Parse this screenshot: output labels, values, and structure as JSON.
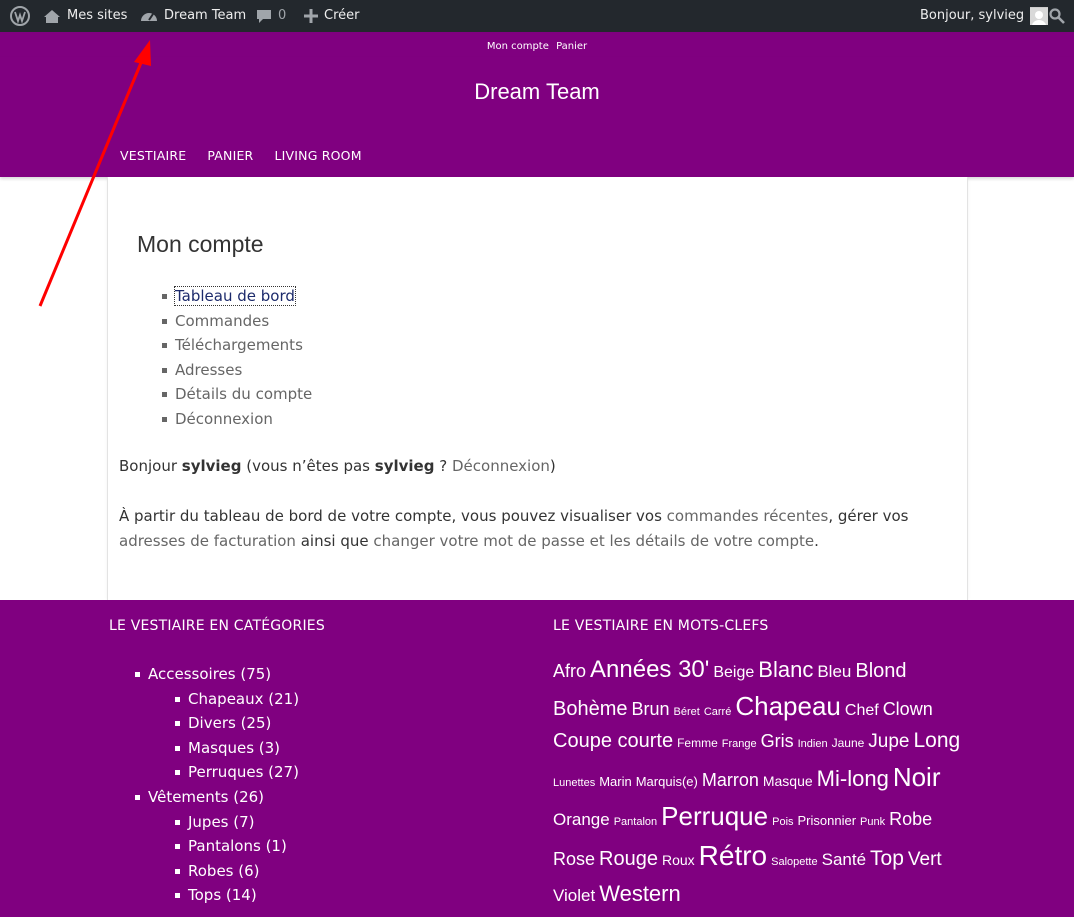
{
  "adminbar": {
    "items": [
      {
        "label": "Mes sites"
      },
      {
        "label": "Dream Team"
      },
      {
        "label": "0"
      },
      {
        "label": "Créer"
      }
    ],
    "greeting": "Bonjour, sylvieg"
  },
  "topbar": {
    "links": [
      "Mon compte",
      "Panier"
    ]
  },
  "header": {
    "site_title": "Dream Team",
    "nav": [
      "VESTIAIRE",
      "PANIER",
      "LIVING ROOM"
    ]
  },
  "content": {
    "page_title": "Mon compte",
    "account_nav": [
      "Tableau de bord",
      "Commandes",
      "Téléchargements",
      "Adresses",
      "Détails du compte",
      "Déconnexion"
    ],
    "greeting": {
      "hello": "Bonjour",
      "user1": "sylvieg",
      "middle": "(vous n’êtes pas",
      "user2": "sylvieg",
      "question": "?",
      "logout": "Déconnexion",
      "close": ")"
    },
    "intro": {
      "p1": "À partir du tableau de bord de votre compte, vous pouvez visualiser vos",
      "link1": "commandes récentes",
      "p2": ", gérer vos",
      "link2": "adresses de facturation",
      "p3": "ainsi que",
      "link3": "changer votre mot de passe et les détails de votre compte",
      "p4": "."
    }
  },
  "footer": {
    "categories_heading": "LE VESTIAIRE EN CATÉGORIES",
    "tags_heading": "LE VESTIAIRE EN MOTS-CLEFS",
    "categories": [
      {
        "label": "Accessoires (75)",
        "children": [
          "Chapeaux (21)",
          "Divers (25)",
          "Masques (3)",
          "Perruques (27)"
        ]
      },
      {
        "label": "Vêtements (26)",
        "children": [
          "Jupes (7)",
          "Pantalons (1)",
          "Robes (6)",
          "Tops (14)"
        ]
      }
    ],
    "tag_rows": [
      [
        {
          "t": "Afro",
          "s": 18
        },
        {
          "t": "Années 30'",
          "s": 24
        },
        {
          "t": "Beige",
          "s": 16
        },
        {
          "t": "Blanc",
          "s": 22
        },
        {
          "t": "Bleu",
          "s": 17
        },
        {
          "t": "Blond",
          "s": 20
        }
      ],
      [
        {
          "t": "Bohème",
          "s": 20
        },
        {
          "t": "Brun",
          "s": 18
        },
        {
          "t": "Béret",
          "s": 11
        },
        {
          "t": "Carré",
          "s": 11
        },
        {
          "t": "Chapeau",
          "s": 26
        },
        {
          "t": "Chef",
          "s": 16
        },
        {
          "t": "Clown",
          "s": 18
        }
      ],
      [
        {
          "t": "Coupe courte",
          "s": 20
        },
        {
          "t": "Femme",
          "s": 12
        },
        {
          "t": "Frange",
          "s": 11
        },
        {
          "t": "Gris",
          "s": 18
        },
        {
          "t": "Indien",
          "s": 11
        },
        {
          "t": "Jaune",
          "s": 12
        },
        {
          "t": "Jupe",
          "s": 19
        },
        {
          "t": "Long",
          "s": 21
        }
      ],
      [
        {
          "t": "Lunettes",
          "s": 11
        },
        {
          "t": "Marin",
          "s": 13
        },
        {
          "t": "Marquis(e)",
          "s": 13
        },
        {
          "t": "Marron",
          "s": 18
        },
        {
          "t": "Masque",
          "s": 14
        },
        {
          "t": "Mi-long",
          "s": 22
        },
        {
          "t": "Noir",
          "s": 26
        }
      ],
      [
        {
          "t": "Orange",
          "s": 17
        },
        {
          "t": "Pantalon",
          "s": 11
        },
        {
          "t": "Perruque",
          "s": 26
        },
        {
          "t": "Pois",
          "s": 11
        },
        {
          "t": "Prisonnier",
          "s": 13
        },
        {
          "t": "Punk",
          "s": 11
        },
        {
          "t": "Robe",
          "s": 18
        }
      ],
      [
        {
          "t": "Rose",
          "s": 18
        },
        {
          "t": "Rouge",
          "s": 20
        },
        {
          "t": "Roux",
          "s": 14
        },
        {
          "t": "Rétro",
          "s": 28
        },
        {
          "t": "Salopette",
          "s": 11
        },
        {
          "t": "Santé",
          "s": 17
        },
        {
          "t": "Top",
          "s": 21
        },
        {
          "t": "Vert",
          "s": 19
        }
      ],
      [
        {
          "t": "Violet",
          "s": 17
        },
        {
          "t": "Western",
          "s": 22
        }
      ]
    ]
  },
  "colors": {
    "purple": "#800080",
    "adminbar": "#23282d",
    "arrow": "#ff0000"
  }
}
